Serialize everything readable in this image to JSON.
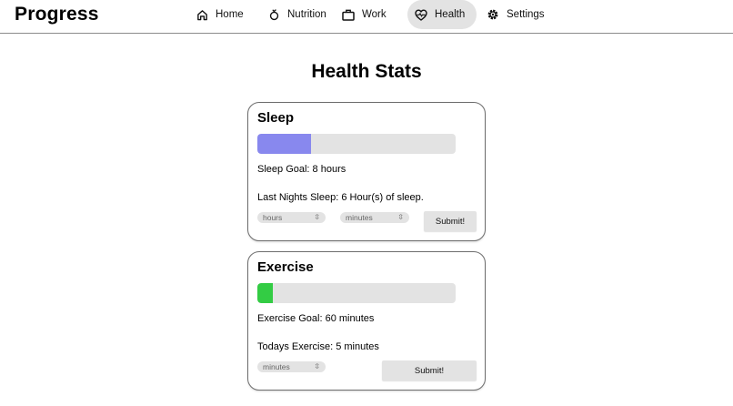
{
  "app": {
    "brand": "Progress"
  },
  "nav": {
    "items": [
      {
        "label": "Home",
        "icon": "home-icon"
      },
      {
        "label": "Nutrition",
        "icon": "apple-icon"
      },
      {
        "label": "Work",
        "icon": "briefcase-icon"
      },
      {
        "label": "Health",
        "icon": "heart-pulse-icon",
        "active": true
      },
      {
        "label": "Settings",
        "icon": "gear-icon"
      }
    ]
  },
  "page": {
    "title": "Health Stats"
  },
  "sleep": {
    "title": "Sleep",
    "progress": 0.27,
    "color": "#8888ee",
    "goal_text": "Sleep Goal: 8 hours",
    "last_text": "Last Nights Sleep: 6 Hour(s) of sleep.",
    "hours_placeholder": "hours",
    "minutes_placeholder": "minutes",
    "submit_label": "Submit!"
  },
  "exercise": {
    "title": "Exercise",
    "progress": 0.08,
    "color": "#33cc44",
    "goal_text": "Exercise Goal: 60 minutes",
    "today_text": "Todays Exercise: 5 minutes",
    "minutes_placeholder": "minutes",
    "submit_label": "Submit!"
  }
}
